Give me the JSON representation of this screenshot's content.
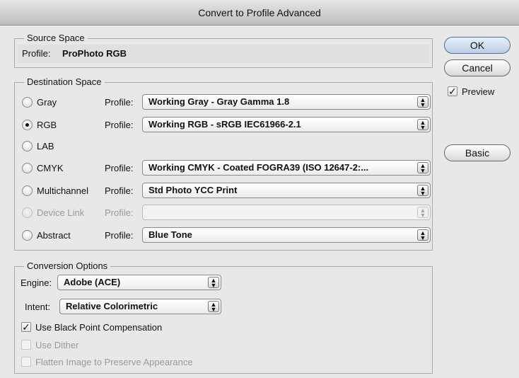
{
  "window": {
    "title": "Convert to Profile Advanced"
  },
  "source": {
    "legend": "Source Space",
    "profile_label": "Profile:",
    "profile_value": "ProPhoto RGB"
  },
  "destination": {
    "legend": "Destination Space",
    "profile_label": "Profile:",
    "rows": [
      {
        "label": "Gray",
        "selected": false,
        "profile": "Working Gray - Gray Gamma 1.8",
        "enabled": true
      },
      {
        "label": "RGB",
        "selected": true,
        "profile": "Working RGB - sRGB IEC61966-2.1",
        "enabled": true
      },
      {
        "label": "LAB",
        "selected": false,
        "profile": "",
        "enabled": true
      },
      {
        "label": "CMYK",
        "selected": false,
        "profile": "Working CMYK - Coated FOGRA39 (ISO 12647-2:...",
        "enabled": true
      },
      {
        "label": "Multichannel",
        "selected": false,
        "profile": "Std Photo YCC Print",
        "enabled": true
      },
      {
        "label": "Device Link",
        "selected": false,
        "profile": "",
        "enabled": false
      },
      {
        "label": "Abstract",
        "selected": false,
        "profile": "Blue Tone",
        "enabled": true
      }
    ]
  },
  "conversion": {
    "legend": "Conversion Options",
    "engine_label": "Engine:",
    "engine_value": "Adobe (ACE)",
    "intent_label": "Intent:",
    "intent_value": "Relative Colorimetric",
    "options": [
      {
        "label": "Use Black Point Compensation",
        "checked": true,
        "enabled": true
      },
      {
        "label": "Use Dither",
        "checked": false,
        "enabled": false
      },
      {
        "label": "Flatten Image to Preserve Appearance",
        "checked": false,
        "enabled": false
      }
    ]
  },
  "buttons": {
    "ok": "OK",
    "cancel": "Cancel",
    "basic": "Basic"
  },
  "preview": {
    "label": "Preview",
    "checked": true
  }
}
